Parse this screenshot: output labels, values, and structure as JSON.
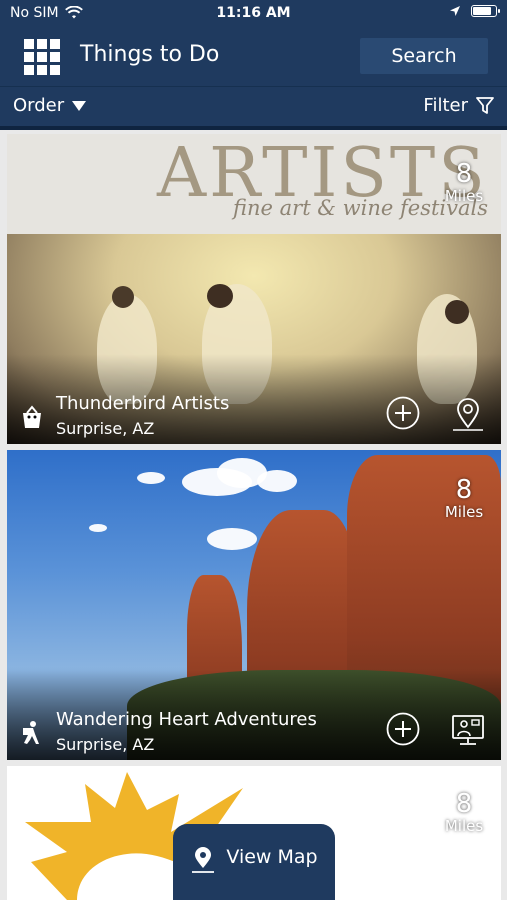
{
  "status": {
    "carrier": "No SIM",
    "time": "11:16 AM"
  },
  "header": {
    "title": "Things to Do",
    "search_label": "Search"
  },
  "toolbar": {
    "order_label": "Order",
    "filter_label": "Filter"
  },
  "cards": [
    {
      "banner_title": "ARTISTS",
      "banner_subtitle": "fine art & wine festivals",
      "name": "Thunderbird Artists",
      "location": "Surprise, AZ",
      "distance_value": "8",
      "distance_unit": "Miles",
      "category_icon": "shopping-bag-icon",
      "action_icon": "map-pin-icon"
    },
    {
      "name": "Wandering Heart Adventures",
      "location": "Surprise, AZ",
      "distance_value": "8",
      "distance_unit": "Miles",
      "category_icon": "hiker-icon",
      "action_icon": "virtual-tour-icon"
    },
    {
      "distance_value": "8",
      "distance_unit": "Miles"
    }
  ],
  "view_map_label": "View Map",
  "colors": {
    "header_bg": "#1f3a5f",
    "search_bg": "#2a4a73",
    "accent_gold": "#f0b429"
  }
}
